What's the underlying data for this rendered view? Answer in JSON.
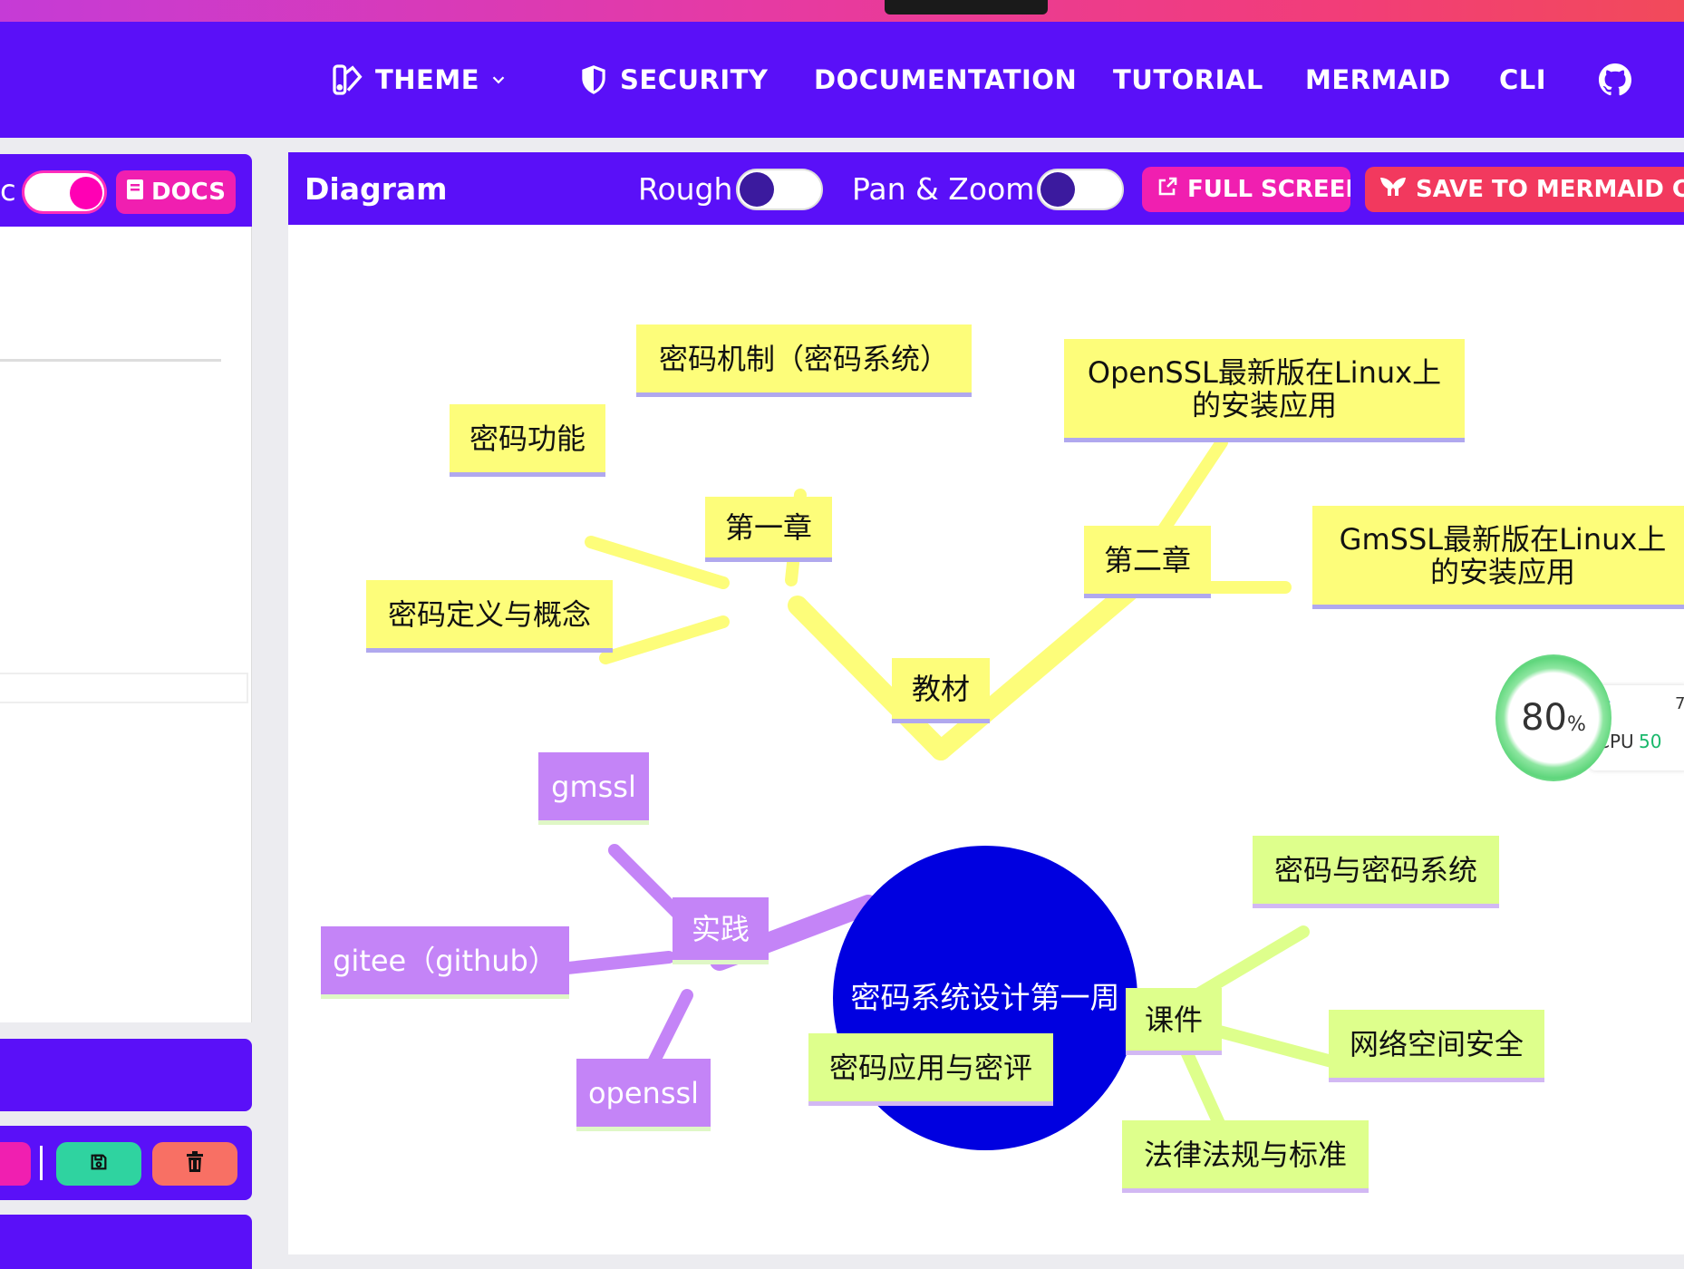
{
  "nav": {
    "items": [
      {
        "label": "THEME",
        "icon": "theme-icon",
        "dropdown": true
      },
      {
        "label": "SECURITY",
        "icon": "shield-icon"
      },
      {
        "label": "DOCUMENTATION"
      },
      {
        "label": "TUTORIAL"
      },
      {
        "label": "MERMAID"
      },
      {
        "label": "CLI"
      }
    ],
    "github_icon": "github-icon"
  },
  "left_panel": {
    "partial_label": "c",
    "docs_label": "DOCS"
  },
  "diagram_panel": {
    "title": "Diagram",
    "rough_label": "Rough",
    "pan_zoom_label": "Pan & Zoom",
    "fullscreen_label": "FULL SCREEN",
    "save_label": "SAVE TO MERMAID CHA"
  },
  "mindmap": {
    "root": "密码系统设计第一周",
    "branches": {
      "textbook": "教材",
      "chapter1": "第一章",
      "ch1_items": [
        "密码机制（密码系统）",
        "密码功能",
        "密码定义与概念"
      ],
      "chapter2": "第二章",
      "ch2_items": [
        "OpenSSL最新版在Linux上的安装应用",
        "GmSSL最新版在Linux上的安装应用"
      ],
      "practice": "实践",
      "practice_items": [
        "gmssl",
        "gitee（github）",
        "openssl"
      ],
      "courseware": "课件",
      "courseware_items": [
        "密码与密码系统",
        "网络空间安全",
        "密码应用与密评",
        "法律法规与标准"
      ]
    }
  },
  "cpu_widget": {
    "percent": "80",
    "percent_unit": "%",
    "cpu_label": "CPU",
    "cpu_value": "50",
    "top_value": "7"
  },
  "colors": {
    "nav_bg": "#5a10f8",
    "accent_pink": "#f01fb0",
    "save_btn": "#f2395e",
    "root_node": "#0000e0",
    "yellow_node": "#fdfd7a",
    "purple_node": "#c484f7",
    "green_node": "#deff8c"
  }
}
